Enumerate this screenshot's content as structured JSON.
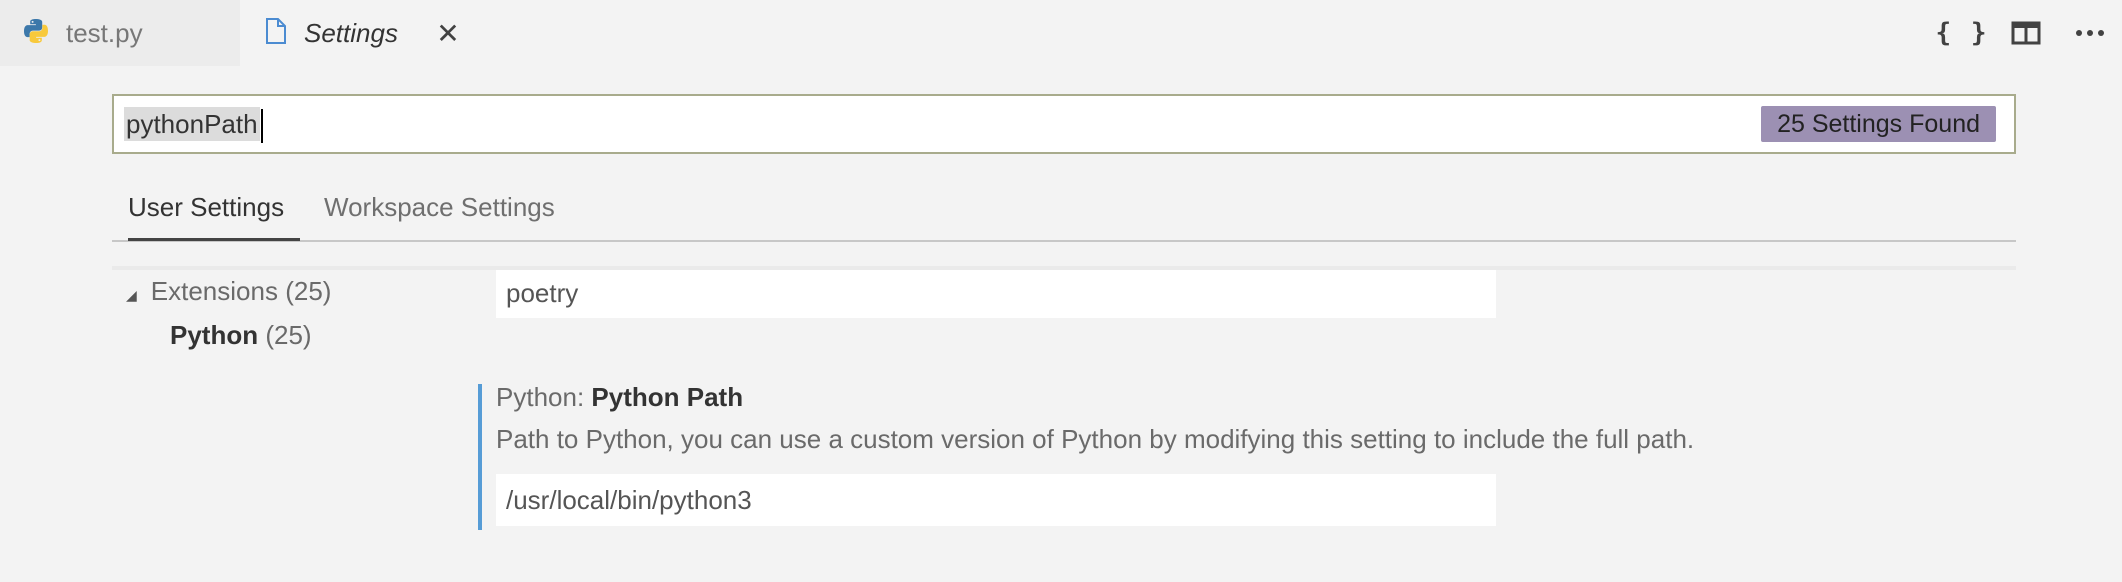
{
  "tabs": [
    {
      "label": "test.py",
      "icon": "python-icon"
    },
    {
      "label": "Settings",
      "icon": "file-icon",
      "close": "✕"
    }
  ],
  "actions": {
    "json_braces": "{ }",
    "split_icon": "split-editor-icon",
    "more_icon": "ellipsis-icon"
  },
  "search": {
    "value": "pythonPath",
    "results": "25 Settings Found"
  },
  "scopes": {
    "user": "User Settings",
    "workspace": "Workspace Settings"
  },
  "tree": {
    "extensions_label": "Extensions",
    "extensions_count": "(25)",
    "python_label": "Python",
    "python_count": "(25)"
  },
  "settings": [
    {
      "value": "poetry"
    },
    {
      "category": "Python: ",
      "name": "Python Path",
      "description": "Path to Python, you can use a custom version of Python by modifying this setting to include the full path.",
      "value": "/usr/local/bin/python3"
    }
  ],
  "colors": {
    "accent_bar": "#569cd6",
    "badge": "#9c90b3"
  }
}
